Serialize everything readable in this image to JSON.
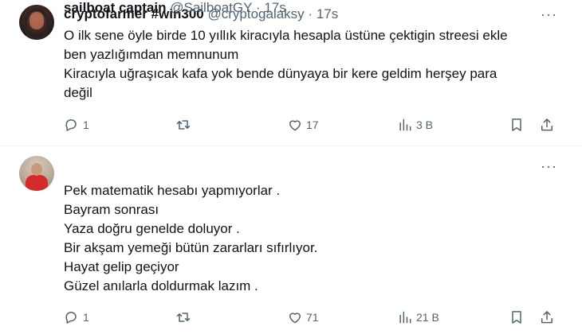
{
  "tweets": [
    {
      "name": "cryptofarmer #win300",
      "handle": "@cryptogalaksy",
      "separator": "·",
      "time": "17s",
      "more": "···",
      "lines": [
        "O ilk sene öyle birde 10 yıllık kiracıyla hesapla üstüne çektigin streesi ekle",
        "ben yazlığımdan memnunum",
        "Kiracıyla uğraşıcak kafa yok bende dünyaya bir kere geldim herşey para",
        "değil"
      ],
      "stats": {
        "replies": "1",
        "retweets": "",
        "likes": "17",
        "views": "3 B"
      }
    },
    {
      "name": "sailboat captain",
      "handle": "@SailboatGY",
      "separator": "·",
      "time": "17s",
      "more": "···",
      "lines": [
        "Pek matematik hesabı yapmıyorlar .",
        "Bayram sonrası",
        "Yaza doğru genelde doluyor .",
        "Bir akşam yemeği bütün zararları sıfırlıyor.",
        "Hayat gelip geçiyor",
        "Güzel anılarla doldurmak lazım ."
      ],
      "stats": {
        "replies": "1",
        "retweets": "",
        "likes": "71",
        "views": "21 B"
      }
    }
  ],
  "icons": {
    "reply": "reply-icon",
    "retweet": "retweet-icon",
    "like": "heart-icon",
    "views": "views-icon",
    "bookmark": "bookmark-icon",
    "share": "share-icon"
  }
}
